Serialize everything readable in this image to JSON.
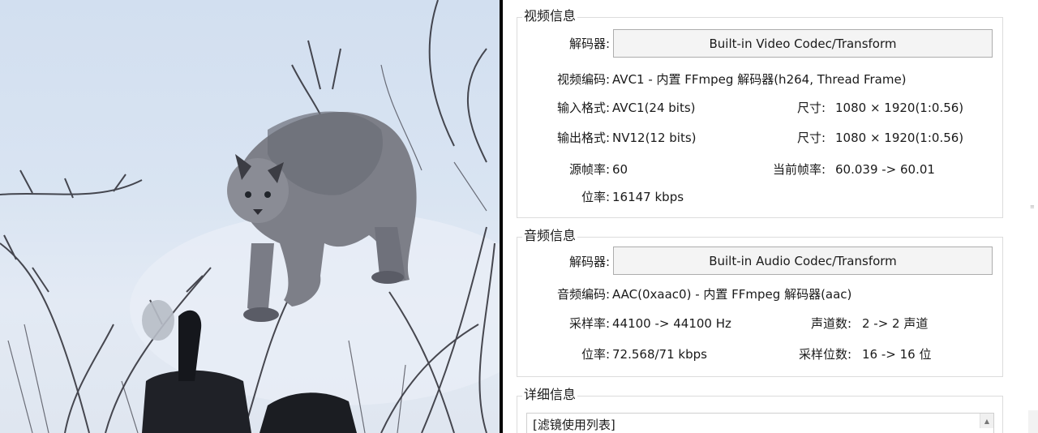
{
  "video_section": {
    "title": "视频信息",
    "decoder_label": "解码器:",
    "decoder_button": "Built-in Video Codec/Transform",
    "codec_label": "视频编码:",
    "codec_value": "AVC1 - 内置 FFmpeg 解码器(h264, Thread Frame)",
    "input_format_label": "输入格式:",
    "input_format_value": "AVC1(24 bits)",
    "input_size_label": "尺寸:",
    "input_size_value": "1080 × 1920(1:0.56)",
    "output_format_label": "输出格式:",
    "output_format_value": "NV12(12 bits)",
    "output_size_label": "尺寸:",
    "output_size_value": "1080 × 1920(1:0.56)",
    "source_fps_label": "源帧率:",
    "source_fps_value": "60",
    "current_fps_label": "当前帧率:",
    "current_fps_value": "60.039 -> 60.01",
    "bitrate_label": "位率:",
    "bitrate_value": "16147 kbps"
  },
  "audio_section": {
    "title": "音频信息",
    "decoder_label": "解码器:",
    "decoder_button": "Built-in Audio Codec/Transform",
    "codec_label": "音频编码:",
    "codec_value": "AAC(0xaac0) - 内置 FFmpeg 解码器(aac)",
    "sample_rate_label": "采样率:",
    "sample_rate_value": "44100 -> 44100 Hz",
    "channels_label": "声道数:",
    "channels_value": "2 -> 2 声道",
    "bitrate_label": "位率:",
    "bitrate_value": "72.568/71 kbps",
    "bit_depth_label": "采样位数:",
    "bit_depth_value": "16 -> 16 位"
  },
  "detail_section": {
    "title": "详细信息",
    "list_first_line": "[滤镜使用列表]"
  },
  "icons": {
    "scroll_up": "scroll-up-arrow-icon",
    "grip": "resize-grip-icon"
  }
}
